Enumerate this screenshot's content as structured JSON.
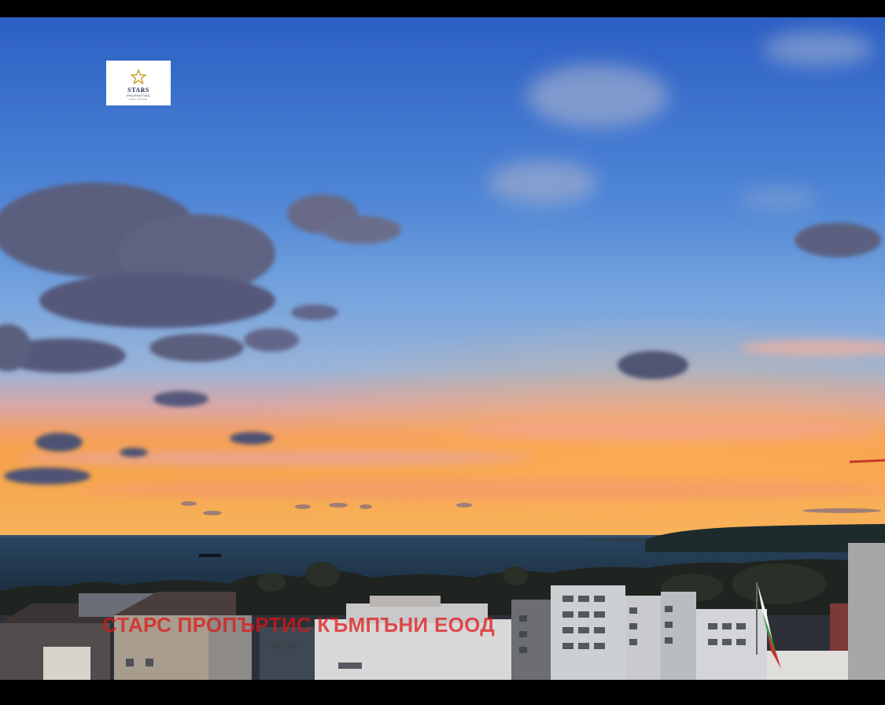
{
  "photo": {
    "subject": "sunset over sea and city rooftops",
    "colors": {
      "sky_top": "#2f63c6",
      "sky_mid": "#5d8fd6",
      "horizon_glow": "#f7a04e",
      "sea": "#1d3447",
      "clouds": "#5c5f78"
    }
  },
  "logo": {
    "name": "STARS",
    "sub": "PROPERTIES",
    "sub2": "REAL ESTATE",
    "icon": "star-icon",
    "star_color": "#c9a63a"
  },
  "watermark": {
    "text": "СТАРС ПРОПЪРТИС КЪМПЪНИ ЕООД"
  }
}
